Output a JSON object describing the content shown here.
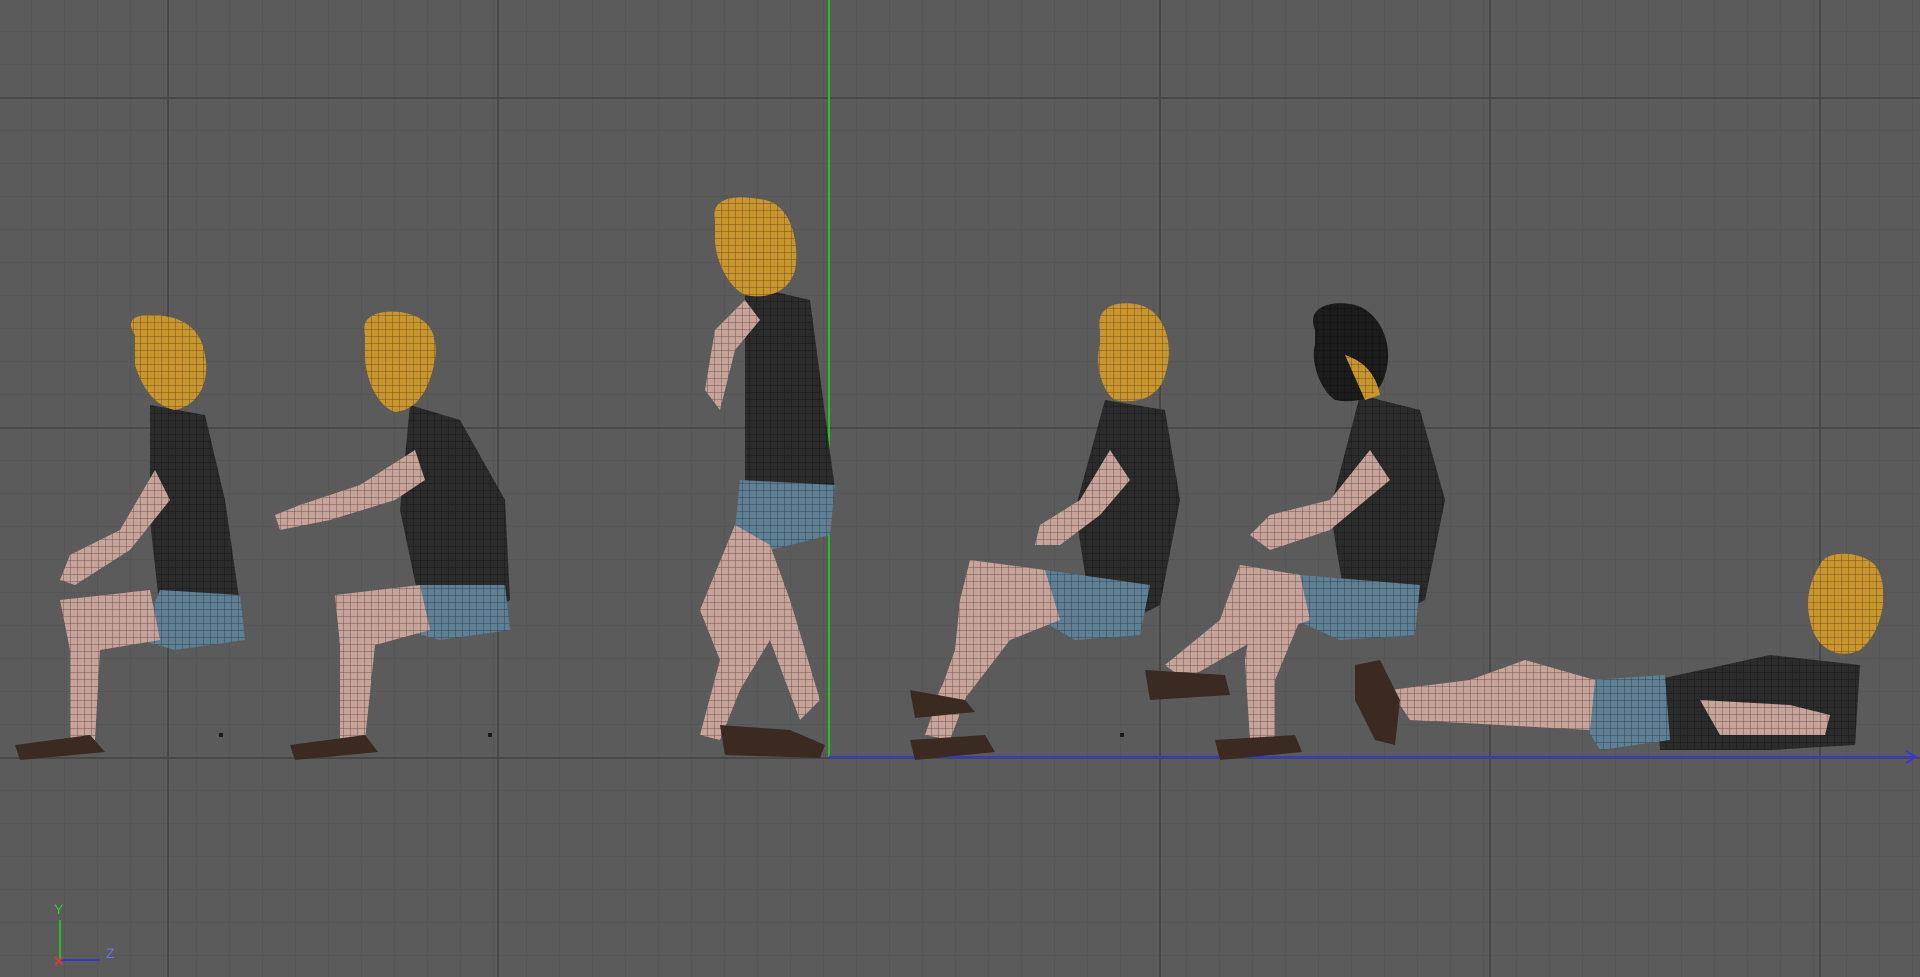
{
  "viewport": {
    "axes": {
      "y_label": "Y",
      "z_label": "Z",
      "y_color": "#22c122",
      "z_color": "#3a36d6",
      "x_color": "#d23a3a"
    },
    "colors": {
      "grid_major": "#4a4a4a",
      "grid_minor": "#565656",
      "background": "#5b5b5b",
      "hair": "#c9962e",
      "skin": "#c8a39a",
      "shirt": "#2b2b2b",
      "shorts": "#5f8094",
      "shoe": "#3a2a22"
    },
    "figures": [
      {
        "name": "figure-1-seated",
        "pose": "seated"
      },
      {
        "name": "figure-2-seated-reaching",
        "pose": "seated-reaching"
      },
      {
        "name": "figure-3-standing-crouch",
        "pose": "standing"
      },
      {
        "name": "figure-4-seated-knee-raised",
        "pose": "seated-knee-raised"
      },
      {
        "name": "figure-5-seated-leg-extended",
        "pose": "seated-leg-extended"
      },
      {
        "name": "figure-6-lying",
        "pose": "lying"
      }
    ]
  }
}
